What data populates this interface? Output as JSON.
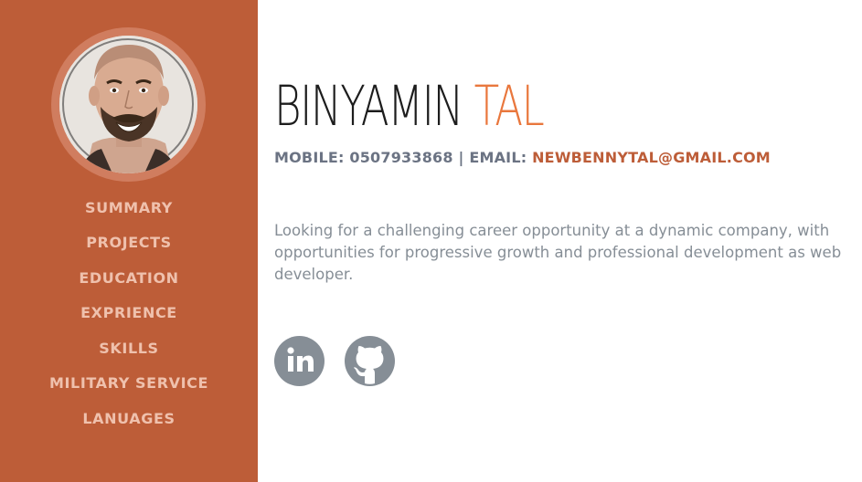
{
  "profile": {
    "avatar_icon": "profile-photo"
  },
  "nav": {
    "items": [
      {
        "label": "SUMMARY"
      },
      {
        "label": "PROJECTS"
      },
      {
        "label": "EDUCATION"
      },
      {
        "label": "EXPRIENCE"
      },
      {
        "label": "SKILLS"
      },
      {
        "label": "MILITARY SERVICE"
      },
      {
        "label": "LANUAGES"
      }
    ]
  },
  "header": {
    "first_name": "BINYAMIN",
    "last_name": "TAL"
  },
  "contact": {
    "mobile_label": "MOBILE:",
    "mobile": "0507933868",
    "separator": "|",
    "email_label": "EMAIL:",
    "email": "NEWBENNYTAL@GMAIL.COM"
  },
  "summary": {
    "text": "Looking for a challenging career opportunity at a dynamic company, with opportunities for progressive growth and professional development as web developer."
  },
  "social": {
    "linkedin_icon": "linkedin-icon",
    "github_icon": "github-icon"
  },
  "colors": {
    "sidebar": "#bd5d38",
    "accent": "#e9773d",
    "nav_text": "#efc1ad",
    "body_text": "#868e96",
    "contact_text": "#6b7383"
  }
}
